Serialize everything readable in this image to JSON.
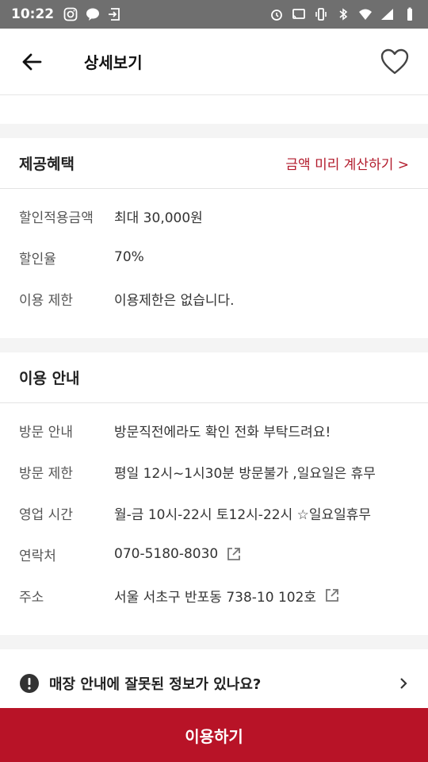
{
  "status_bar": {
    "time": "10:22"
  },
  "header": {
    "title": "상세보기"
  },
  "benefits": {
    "title": "제공혜택",
    "calc_link": "금액 미리 계산하기 >",
    "rows": [
      {
        "label": "할인적용금액",
        "value": "최대 30,000원"
      },
      {
        "label": "할인율",
        "value": "70%"
      },
      {
        "label": "이용 제한",
        "value": "이용제한은 없습니다."
      }
    ]
  },
  "usage": {
    "title": "이용 안내",
    "rows": [
      {
        "label": "방문 안내",
        "value": "방문직전에라도 확인 전화 부탁드려요!"
      },
      {
        "label": "방문 제한",
        "value": "평일 12시~1시30분 방문불가 ,일요일은 휴무"
      },
      {
        "label": "영업 시간",
        "value": "월-금 10시-22시 토12시-22시 ☆일요일휴무"
      },
      {
        "label": "연락처",
        "value": "070-5180-8030"
      },
      {
        "label": "주소",
        "value": "서울 서초구 반포동 738-10 102호"
      }
    ]
  },
  "report": {
    "text": "매장 안내에 잘못된 정보가 있나요?"
  },
  "cta": {
    "label": "이용하기"
  },
  "colors": {
    "accent": "#b81327",
    "link": "#b21a2b",
    "status_bar": "#6f6f6f"
  }
}
